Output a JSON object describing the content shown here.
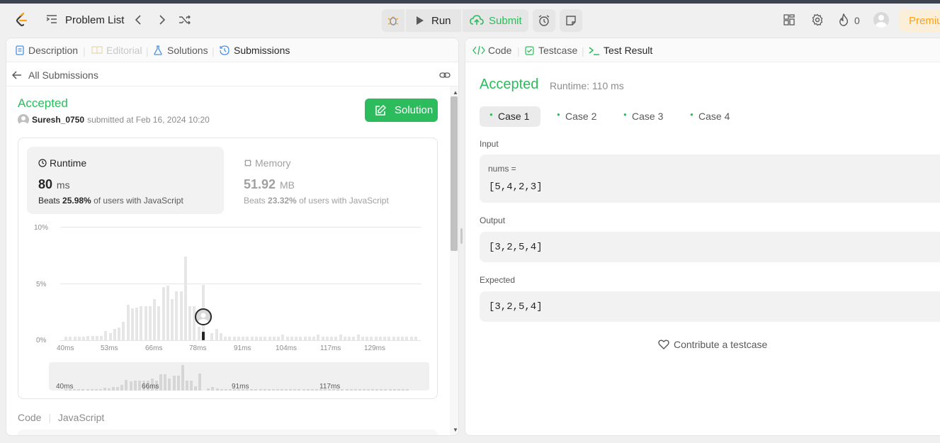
{
  "topbar": {
    "problem_list": "Problem List",
    "run": "Run",
    "submit": "Submit",
    "streak_count": "0",
    "premium": "Premium"
  },
  "left": {
    "tabs": [
      "Description",
      "Editorial",
      "Solutions",
      "Submissions"
    ],
    "all_submissions": "All Submissions",
    "status": "Accepted",
    "username": "Suresh_0750",
    "submitted_text": "submitted at Feb 16, 2024 10:20",
    "solution_button": "Solution",
    "runtime": {
      "label": "Runtime",
      "value": "80",
      "unit": "ms",
      "beats_prefix": "Beats",
      "beats": "25.98%",
      "beats_suffix": "of users with JavaScript"
    },
    "memory": {
      "label": "Memory",
      "value": "51.92",
      "unit": "MB",
      "beats_prefix": "Beats",
      "beats": "23.32%",
      "beats_suffix": "of users with JavaScript"
    },
    "code_label": "Code",
    "language": "JavaScript"
  },
  "chart_data": {
    "type": "bar",
    "ylabels": [
      "10%",
      "5%",
      "0%"
    ],
    "xlabels": [
      "40ms",
      "53ms",
      "66ms",
      "78ms",
      "91ms",
      "104ms",
      "117ms",
      "129ms"
    ],
    "mini_labels": [
      "40ms",
      "66ms",
      "91ms",
      "117ms"
    ],
    "ylim": [
      0,
      10
    ],
    "values": [
      0.3,
      0.3,
      0.3,
      0.3,
      0.3,
      0.4,
      0.4,
      0.4,
      0.4,
      0.8,
      0.6,
      1.0,
      1.1,
      1.6,
      3.1,
      2.8,
      2.9,
      3.0,
      3.0,
      3.0,
      3.6,
      3.0,
      4.7,
      4.8,
      3.6,
      4.3,
      4.3,
      7.4,
      3.0,
      3.0,
      1.2,
      4.9,
      3.0,
      0.6,
      1.0,
      0.6,
      0.3,
      0.3,
      0.3,
      0.3,
      0.3,
      0.3,
      0.3,
      0.3,
      0.3,
      0.3,
      0.3,
      0.3,
      0.3,
      0.5,
      0.3,
      0.3,
      0.3,
      0.3,
      0.3,
      0.3,
      0.3,
      0.5,
      0.3,
      0.3,
      0.3,
      0.3,
      0.5,
      0.3,
      0.3,
      0.3,
      0.5,
      0.3,
      0.3,
      0.3,
      0.3,
      0.3,
      0.3,
      0.3,
      0.3,
      0.3,
      0.3,
      0.3,
      0.3,
      0.3
    ],
    "highlight_index": 32,
    "highlight_value": 80
  },
  "right": {
    "tabs": [
      "Code",
      "Testcase",
      "Test Result"
    ],
    "status": "Accepted",
    "runtime": "Runtime: 110 ms",
    "cases": [
      "Case 1",
      "Case 2",
      "Case 3",
      "Case 4"
    ],
    "input_label": "Input",
    "input_var": "nums =",
    "input_value": "[5,4,2,3]",
    "output_label": "Output",
    "output_value": "[3,2,5,4]",
    "expected_label": "Expected",
    "expected_value": "[3,2,5,4]",
    "contribute": "Contribute a testcase"
  }
}
